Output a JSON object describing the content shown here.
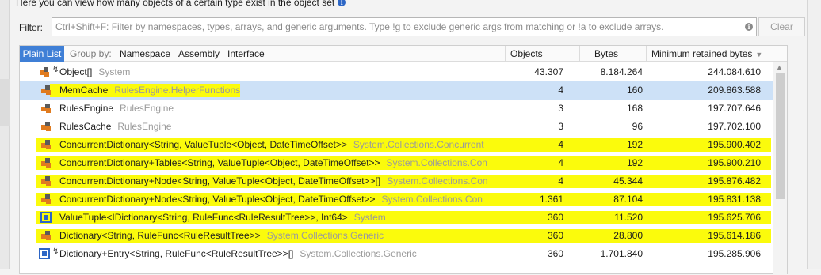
{
  "hint_text": "Here you can view how many objects of a certain type exist in the object set",
  "filter": {
    "label": "Filter:",
    "placeholder": "Ctrl+Shift+F: Filter by namespaces, types, arrays, and generic arguments. Type !g to exclude generic args from matching or !a to exclude arrays.",
    "value": "",
    "clear_label": "Clear"
  },
  "toolbar": {
    "plain_list": "Plain List",
    "group_by": "Group by:",
    "namespace": "Namespace",
    "assembly": "Assembly",
    "interface": "Interface"
  },
  "columns": {
    "objects": "Objects",
    "bytes": "Bytes",
    "retained": "Minimum retained bytes"
  },
  "rows": [
    {
      "icon": "class-icon",
      "flag": "ꟓ",
      "name": "Object[]",
      "ns": "System",
      "objects": "43.307",
      "bytes": "8.184.264",
      "retained": "244.084.610",
      "selected": false,
      "highlight": false
    },
    {
      "icon": "class-icon",
      "flag": "",
      "name": "MemCache",
      "ns": "RulesEngine.HelperFunctions",
      "objects": "4",
      "bytes": "160",
      "retained": "209.863.588",
      "selected": true,
      "highlight": true
    },
    {
      "icon": "class-icon",
      "flag": "",
      "name": "RulesEngine",
      "ns": "RulesEngine",
      "objects": "3",
      "bytes": "168",
      "retained": "197.707.646",
      "selected": false,
      "highlight": false
    },
    {
      "icon": "class-icon",
      "flag": "",
      "name": "RulesCache",
      "ns": "RulesEngine",
      "objects": "3",
      "bytes": "96",
      "retained": "197.702.100",
      "selected": false,
      "highlight": false
    },
    {
      "icon": "class-icon",
      "flag": "",
      "name": "ConcurrentDictionary<String, ValueTuple<Object, DateTimeOffset>>",
      "ns": "System.Collections.Concurrent",
      "objects": "4",
      "bytes": "192",
      "retained": "195.900.402",
      "selected": false,
      "highlight": true
    },
    {
      "icon": "class-icon",
      "flag": "",
      "name": "ConcurrentDictionary+Tables<String, ValueTuple<Object, DateTimeOffset>>",
      "ns": "System.Collections.Con",
      "objects": "4",
      "bytes": "192",
      "retained": "195.900.210",
      "selected": false,
      "highlight": true
    },
    {
      "icon": "class-icon",
      "flag": "",
      "name": "ConcurrentDictionary+Node<String, ValueTuple<Object, DateTimeOffset>>[]",
      "ns": "System.Collections.Con",
      "objects": "4",
      "bytes": "45.344",
      "retained": "195.876.482",
      "selected": false,
      "highlight": true
    },
    {
      "icon": "class-icon",
      "flag": "",
      "name": "ConcurrentDictionary+Node<String, ValueTuple<Object, DateTimeOffset>>",
      "ns": "System.Collections.Con",
      "objects": "1.361",
      "bytes": "87.104",
      "retained": "195.831.138",
      "selected": false,
      "highlight": true
    },
    {
      "icon": "struct-icon",
      "flag": "",
      "name": "ValueTuple<IDictionary<String, RuleFunc<RuleResultTree>>, Int64>",
      "ns": "System",
      "objects": "360",
      "bytes": "11.520",
      "retained": "195.625.706",
      "selected": false,
      "highlight": true
    },
    {
      "icon": "class-icon",
      "flag": "",
      "name": "Dictionary<String, RuleFunc<RuleResultTree>>",
      "ns": "System.Collections.Generic",
      "objects": "360",
      "bytes": "28.800",
      "retained": "195.614.186",
      "selected": false,
      "highlight": true
    },
    {
      "icon": "struct-icon",
      "flag": "ꟓ",
      "name": "Dictionary+Entry<String, RuleFunc<RuleResultTree>>[]",
      "ns": "System.Collections.Generic",
      "objects": "360",
      "bytes": "1.701.840",
      "retained": "195.285.906",
      "selected": false,
      "highlight": false
    }
  ],
  "colors": {
    "accent": "#3f7fd6",
    "selection": "#cde1f7",
    "highlight": "#fbfb0c",
    "class_icon": "#e07b1f",
    "struct_icon": "#2d66c5"
  }
}
